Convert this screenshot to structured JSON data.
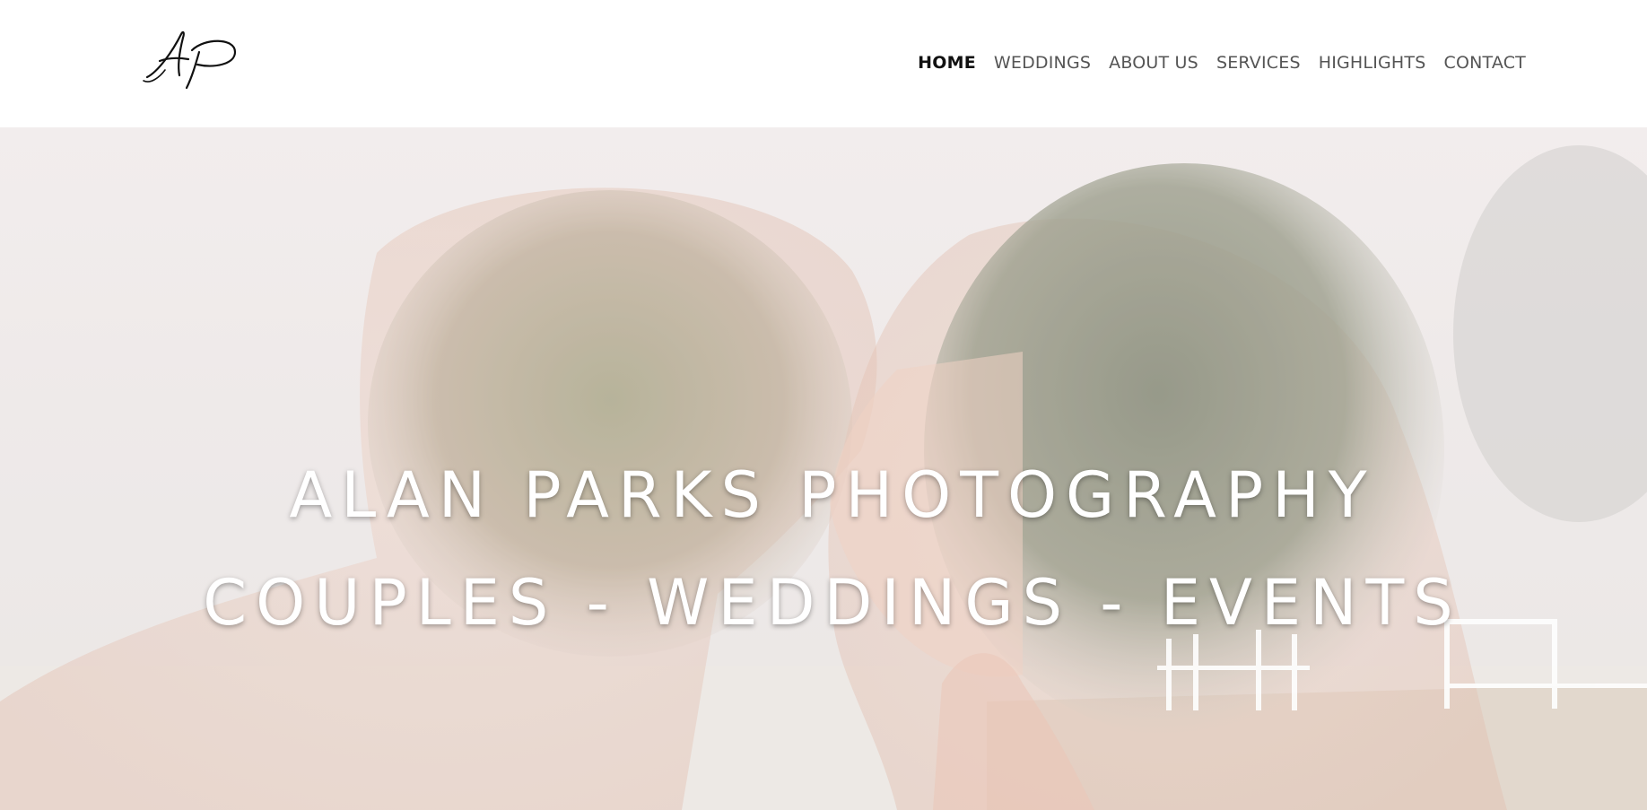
{
  "header": {
    "logo_text": "AP",
    "nav": [
      {
        "label": "HOME",
        "active": true
      },
      {
        "label": "WEDDINGS",
        "active": false
      },
      {
        "label": "ABOUT US",
        "active": false
      },
      {
        "label": "SERVICES",
        "active": false
      },
      {
        "label": "HIGHLIGHTS",
        "active": false
      },
      {
        "label": "CONTACT",
        "active": false
      }
    ]
  },
  "hero": {
    "title": "ALAN PARKS PHOTOGRAPHY",
    "subtitle": "COUPLES - WEDDINGS - EVENTS",
    "image": "double-exposure-couple-kissing-trees-image"
  },
  "colors": {
    "nav_text": "#555555",
    "nav_active": "#111111",
    "hero_text": "#ffffff"
  }
}
